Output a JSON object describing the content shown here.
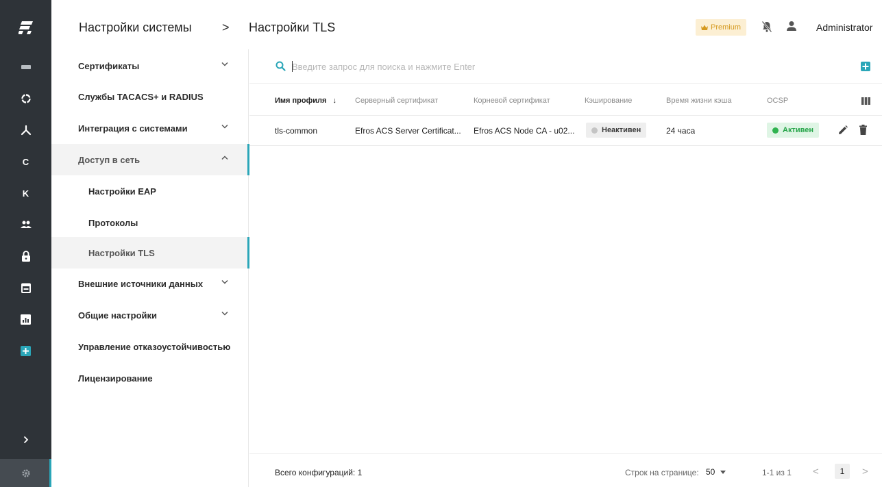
{
  "header": {
    "breadcrumb_parent": "Настройки системы",
    "breadcrumb_separator": ">",
    "breadcrumb_current": "Настройки TLS",
    "premium_label": "Premium",
    "user_name": "Administrator"
  },
  "rail": {
    "items": [
      {
        "icon": "devices-icon"
      },
      {
        "icon": "circle-icon"
      },
      {
        "icon": "network-icon"
      },
      {
        "label": "C"
      },
      {
        "label": "K"
      },
      {
        "icon": "users-icon"
      },
      {
        "icon": "lock-icon"
      },
      {
        "icon": "calendar-icon"
      },
      {
        "icon": "report-icon"
      },
      {
        "icon": "add-icon"
      }
    ],
    "expand_icon": "chevron-right-icon",
    "settings_icon": "gear-icon"
  },
  "sidebar": {
    "items": [
      {
        "label": "Сертификаты",
        "chevron": "down"
      },
      {
        "label": "Службы TACACS+ и RADIUS"
      },
      {
        "label": "Интеграция с системами",
        "chevron": "down"
      },
      {
        "label": "Доступ в сеть",
        "chevron": "up"
      },
      {
        "label": "Настройки EAP"
      },
      {
        "label": "Протоколы"
      },
      {
        "label": "Настройки TLS"
      },
      {
        "label": "Внешние источники данных",
        "chevron": "down"
      },
      {
        "label": "Общие настройки",
        "chevron": "down"
      },
      {
        "label": "Управление отказоустойчивостью"
      },
      {
        "label": "Лицензирование"
      }
    ]
  },
  "search": {
    "placeholder": "Введите запрос для поиска и нажмите Enter"
  },
  "table": {
    "columns": [
      "Имя профиля",
      "Серверный сертификат",
      "Корневой сертификат",
      "Кэширование",
      "Время жизни кэша",
      "OCSP"
    ],
    "sort_indicator": "↓",
    "rows": [
      {
        "name": "tls-common",
        "server_cert": "Efros ACS Server Certificat...",
        "root_cert": "Efros ACS Node CA - u02...",
        "caching": "Неактивен",
        "cache_ttl": "24 часа",
        "ocsp": "Активен"
      }
    ]
  },
  "footer": {
    "total": "Всего конфигураций: 1",
    "rows_per_page_label": "Строк на странице:",
    "rows_per_page_value": "50",
    "range": "1-1 из 1",
    "prev": "<",
    "page": "1",
    "next": ">"
  },
  "colors": {
    "accent": "#2aa6b8",
    "rail_bg": "#2e3338",
    "premium_text": "#d59a21",
    "active_green": "#27a54a"
  }
}
